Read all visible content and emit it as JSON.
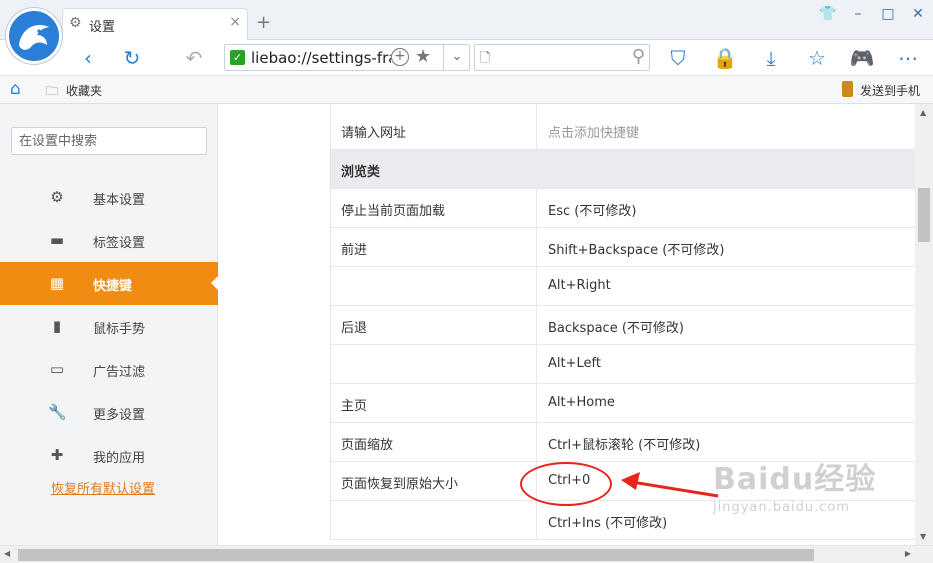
{
  "tab": {
    "title": "设置",
    "close": "×",
    "new_tab": "+"
  },
  "window": {
    "skin": "👕",
    "minimize": "–",
    "maximize": "□",
    "close": "✕"
  },
  "address": {
    "url": "liebao://settings-fra",
    "secure": "✓"
  },
  "search": {
    "doc": "🗋"
  },
  "bookmarks": {
    "folder_label": "收藏夹",
    "send_to_phone": "发送到手机"
  },
  "sidebar": {
    "search_placeholder": "在设置中搜索",
    "items": [
      {
        "label": "基本设置",
        "icon": "gear-icon",
        "glyph": "⚙"
      },
      {
        "label": "标签设置",
        "icon": "laptop-icon",
        "glyph": "▬"
      },
      {
        "label": "快捷键",
        "icon": "shortcut-icon",
        "glyph": "▦",
        "active": true
      },
      {
        "label": "鼠标手势",
        "icon": "mouse-icon",
        "glyph": "▮"
      },
      {
        "label": "广告过滤",
        "icon": "window-icon",
        "glyph": "▭"
      },
      {
        "label": "更多设置",
        "icon": "wrench-icon",
        "glyph": "🔧"
      },
      {
        "label": "我的应用",
        "icon": "puzzle-icon",
        "glyph": "✚"
      }
    ],
    "restore_defaults": "恢复所有默认设置"
  },
  "shortcuts": {
    "rows": [
      {
        "action": "请输入网址",
        "key": "点击添加快捷键",
        "hint": true
      },
      {
        "action": "浏览类",
        "key": "",
        "section": true
      },
      {
        "action": "停止当前页面加载",
        "key": "Esc (不可修改)"
      },
      {
        "action": "前进",
        "key": "Shift+Backspace (不可修改)"
      },
      {
        "action": "",
        "key": "Alt+Right"
      },
      {
        "action": "后退",
        "key": "Backspace (不可修改)"
      },
      {
        "action": "",
        "key": "Alt+Left"
      },
      {
        "action": "主页",
        "key": "Alt+Home"
      },
      {
        "action": "页面缩放",
        "key": "Ctrl+鼠标滚轮 (不可修改)"
      },
      {
        "action": "页面恢复到原始大小",
        "key": "Ctrl+0"
      },
      {
        "action": "",
        "key": "Ctrl+Ins (不可修改)"
      }
    ]
  },
  "watermark": {
    "brand": "Baidu经验",
    "url": "jingyan.baidu.com"
  },
  "colors": {
    "accent": "#f08c12",
    "link": "#e07b1a",
    "annotation": "#e8241b",
    "brand_blue": "#2b7fd6"
  }
}
